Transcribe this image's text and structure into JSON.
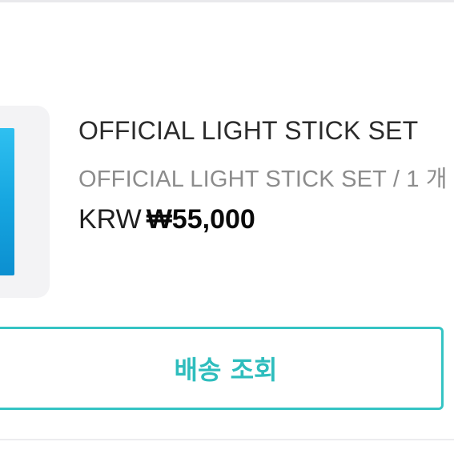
{
  "product": {
    "title": "OFFICIAL LIGHT STICK SET",
    "option": "OFFICIAL LIGHT STICK SET / 1 개",
    "currency": "KRW",
    "price": "₩55,000"
  },
  "actions": {
    "track_label": "배송 조회"
  },
  "colors": {
    "accent": "#35c4c4",
    "thumbnail": "#16a6e0"
  }
}
